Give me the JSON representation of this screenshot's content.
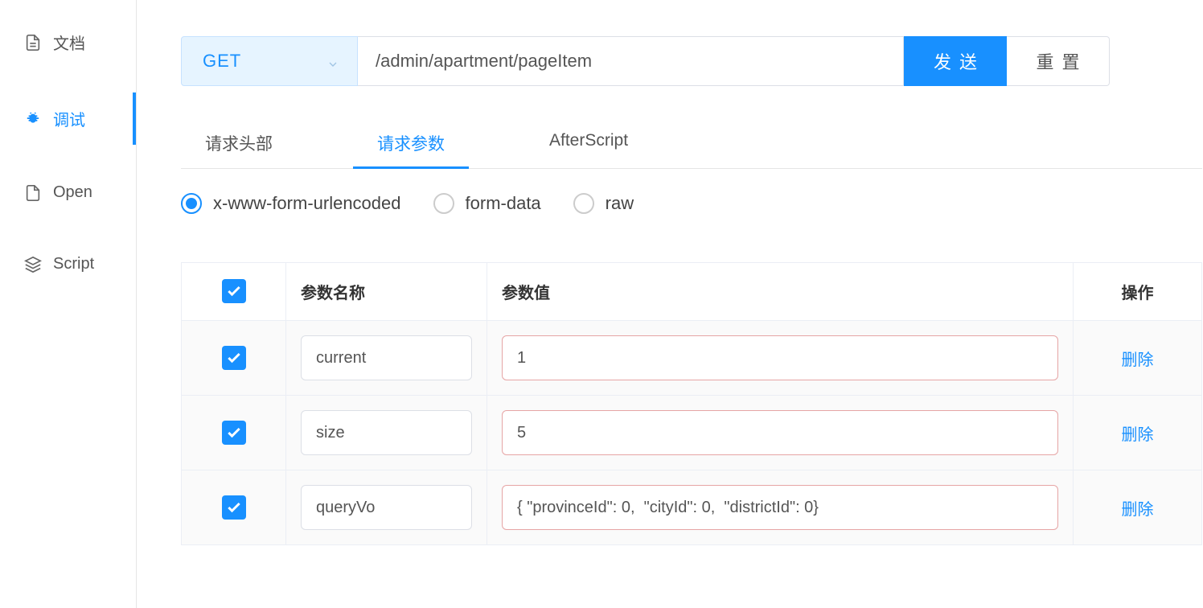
{
  "sidebar": {
    "items": [
      {
        "label": "文档",
        "icon": "document"
      },
      {
        "label": "调试",
        "icon": "bug"
      },
      {
        "label": "Open",
        "icon": "file"
      },
      {
        "label": "Script",
        "icon": "cube"
      }
    ]
  },
  "request": {
    "method": "GET",
    "url": "/admin/apartment/pageItem",
    "send_label": "发送",
    "reset_label": "重置"
  },
  "tabs": [
    {
      "label": "请求头部"
    },
    {
      "label": "请求参数"
    },
    {
      "label": "AfterScript"
    }
  ],
  "body_types": [
    {
      "label": "x-www-form-urlencoded",
      "checked": true
    },
    {
      "label": "form-data",
      "checked": false
    },
    {
      "label": "raw",
      "checked": false
    }
  ],
  "table": {
    "headers": {
      "name": "参数名称",
      "value": "参数值",
      "action": "操作"
    },
    "rows": [
      {
        "name": "current",
        "value": "1",
        "delete": "删除"
      },
      {
        "name": "size",
        "value": "5",
        "delete": "删除"
      },
      {
        "name": "queryVo",
        "value": "{ \"provinceId\": 0,  \"cityId\": 0,  \"districtId\": 0}",
        "delete": "删除"
      }
    ]
  }
}
